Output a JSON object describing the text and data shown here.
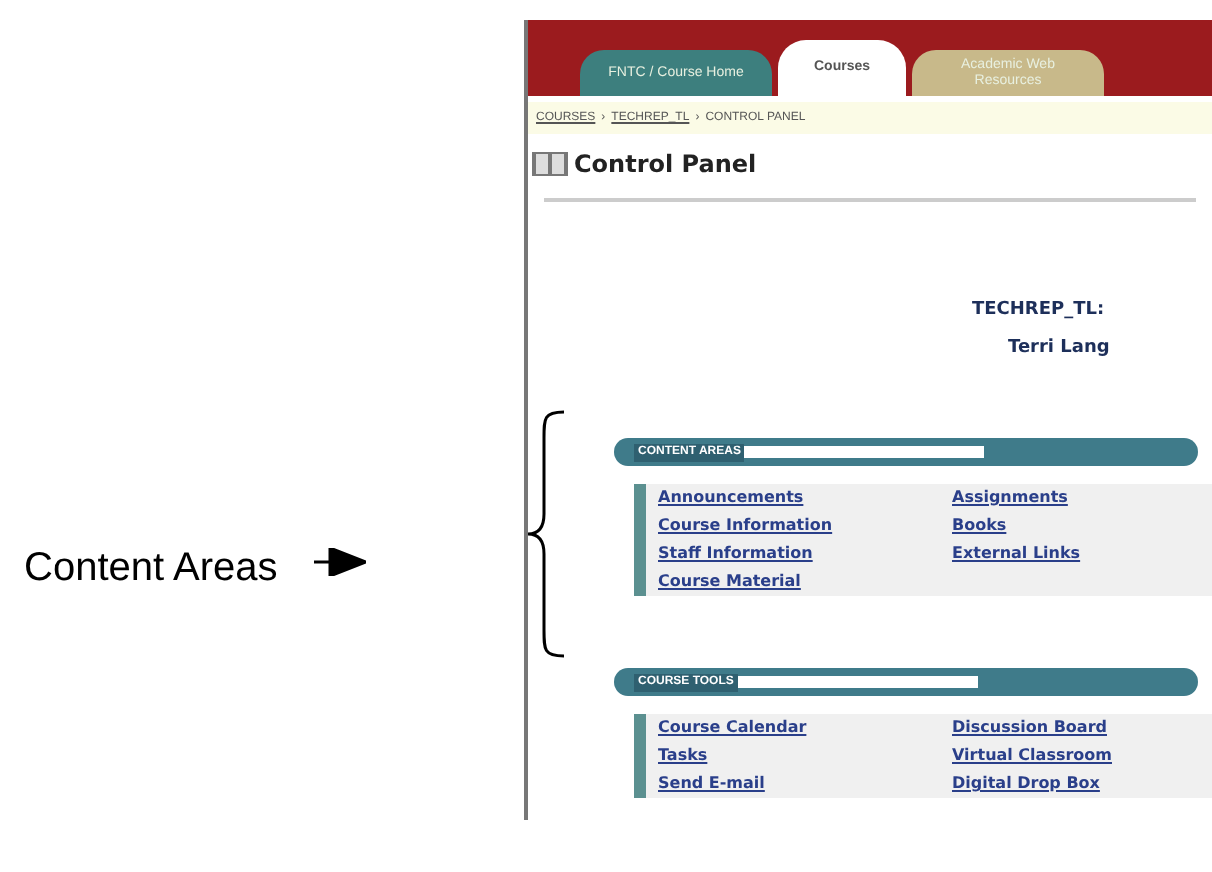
{
  "annotation": {
    "label": "Content Areas"
  },
  "tabs": [
    {
      "label": "FNTC / Course Home",
      "selected": false,
      "color": "#3d7f7e"
    },
    {
      "label": "Courses",
      "selected": true,
      "color": "#ffffff"
    },
    {
      "label": "Academic Web Resources",
      "selected": false,
      "color": "#c8b98a"
    }
  ],
  "breadcrumb": {
    "separator": "›",
    "items": [
      {
        "text": "COURSES",
        "link": true
      },
      {
        "text": "TECHREP_TL",
        "link": true
      },
      {
        "text": "CONTROL PANEL",
        "link": false
      }
    ]
  },
  "page_title": "Control Panel",
  "course": {
    "code": "TECHREP_TL:",
    "instructor": "Terri Lang"
  },
  "sections": [
    {
      "title": "CONTENT AREAS",
      "links": [
        "Announcements",
        "Assignments",
        "Course Information",
        "Books",
        "Staff Information",
        "External Links",
        "Course Material"
      ]
    },
    {
      "title": "COURSE TOOLS",
      "links": [
        "Course Calendar",
        "Discussion Board",
        "Tasks",
        "Virtual Classroom",
        "Send E-mail",
        "Digital Drop Box"
      ]
    }
  ]
}
